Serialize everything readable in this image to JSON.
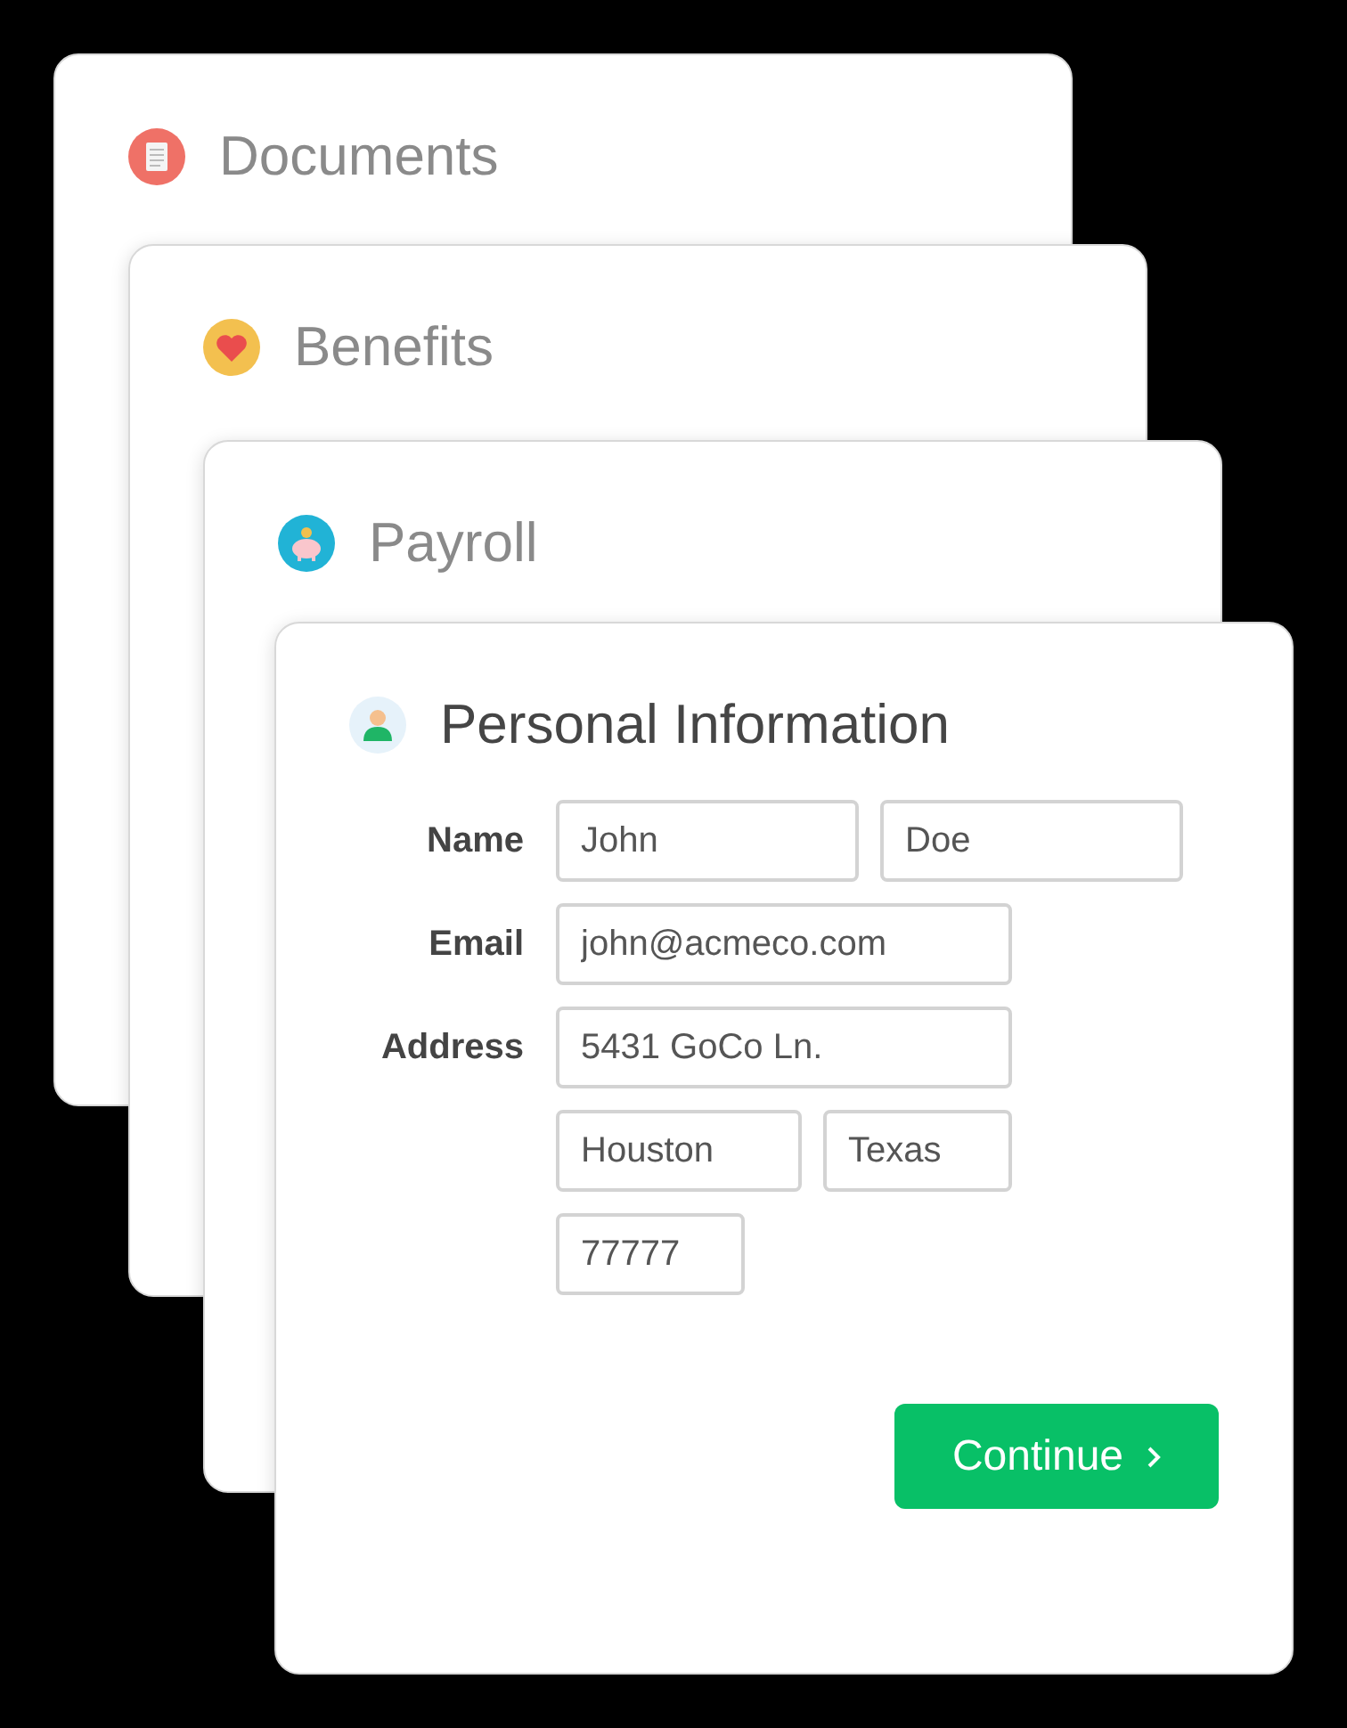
{
  "cards": [
    {
      "title": "Documents"
    },
    {
      "title": "Benefits"
    },
    {
      "title": "Payroll"
    },
    {
      "title": "Personal Information"
    }
  ],
  "form": {
    "rows": [
      {
        "label": "Name",
        "fields": [
          {
            "value": "John"
          },
          {
            "value": "Doe"
          }
        ]
      },
      {
        "label": "Email",
        "fields": [
          {
            "value": "john@acmeco.com"
          }
        ]
      },
      {
        "label": "Address",
        "fields": [
          {
            "value": "5431 GoCo Ln."
          }
        ]
      },
      {
        "fields": [
          {
            "value": "Houston"
          },
          {
            "value": "Texas"
          }
        ]
      },
      {
        "fields": [
          {
            "value": "77777"
          }
        ]
      }
    ],
    "button": {
      "label": "Continue"
    }
  }
}
